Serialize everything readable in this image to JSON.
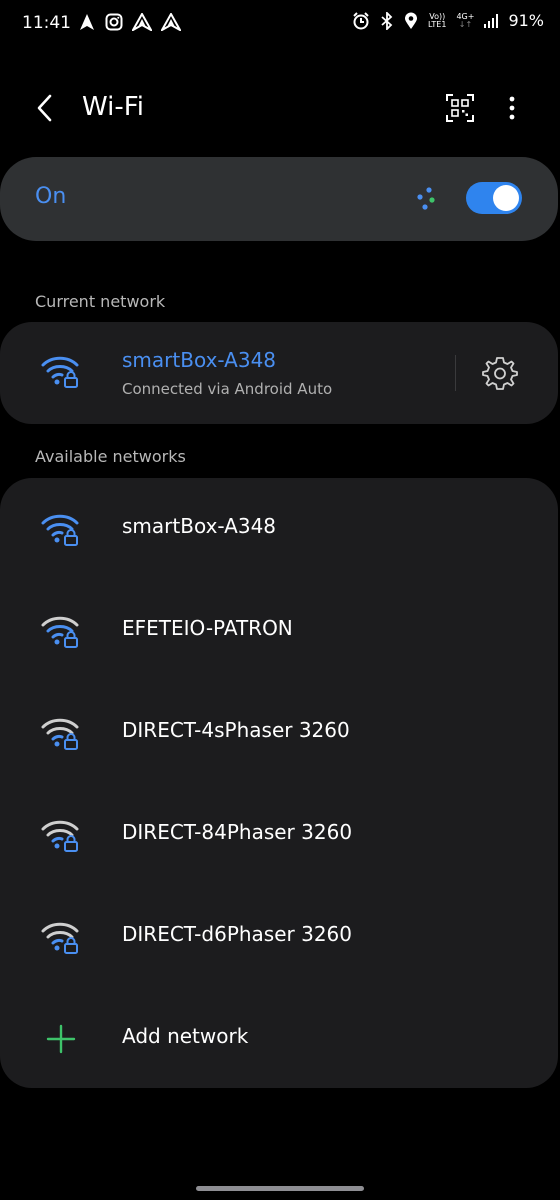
{
  "status_bar": {
    "time": "11:41",
    "network_tag_top": "Vo))",
    "network_tag_bottom": "LTE1",
    "data_tag_top": "4G+",
    "data_tag_bottom": "↓↑",
    "battery": "91%"
  },
  "header": {
    "title": "Wi-Fi"
  },
  "toggle": {
    "label": "On",
    "state": true,
    "accent": "#2f84ee"
  },
  "current_section": {
    "label": "Current network",
    "network": {
      "name": "smartBox-A348",
      "status": "Connected via Android Auto"
    }
  },
  "available_section": {
    "label": "Available networks",
    "networks": [
      {
        "name": "smartBox-A348",
        "icon": "wifi-lock-icon-blue"
      },
      {
        "name": "EFETEIO-PATRON",
        "icon": "wifi-lock-icon"
      },
      {
        "name": "DIRECT-4sPhaser 3260",
        "icon": "wifi-lock-icon"
      },
      {
        "name": "DIRECT-84Phaser 3260",
        "icon": "wifi-lock-icon"
      },
      {
        "name": "DIRECT-d6Phaser 3260",
        "icon": "wifi-lock-icon"
      }
    ],
    "add_label": "Add network"
  },
  "colors": {
    "accent_blue": "#4a8ff1",
    "card_bg": "#1c1c1e",
    "toggle_card_bg": "#2f3133",
    "add_green": "#3ec36a"
  }
}
